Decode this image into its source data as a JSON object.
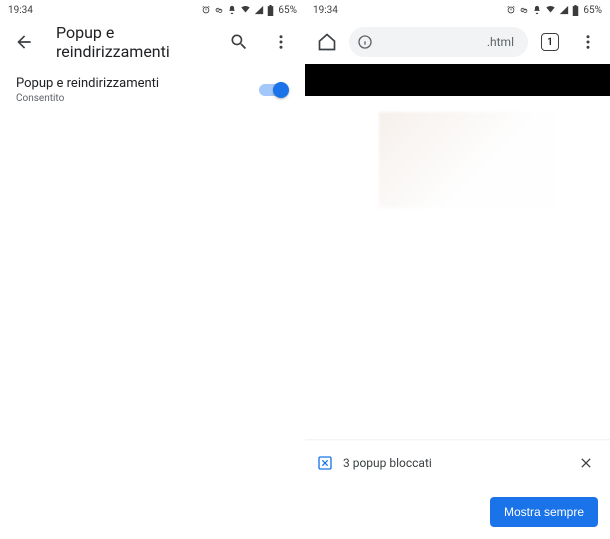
{
  "status": {
    "time": "19:34",
    "battery_text": "65%"
  },
  "left": {
    "header_title": "Popup e reindirizzamenti",
    "setting_title": "Popup e reindirizzamenti",
    "setting_sub": "Consentito"
  },
  "right": {
    "url_suffix": ".html",
    "tab_count": "1",
    "sheet_message": "3 popup bloccati",
    "sheet_button": "Mostra sempre"
  }
}
